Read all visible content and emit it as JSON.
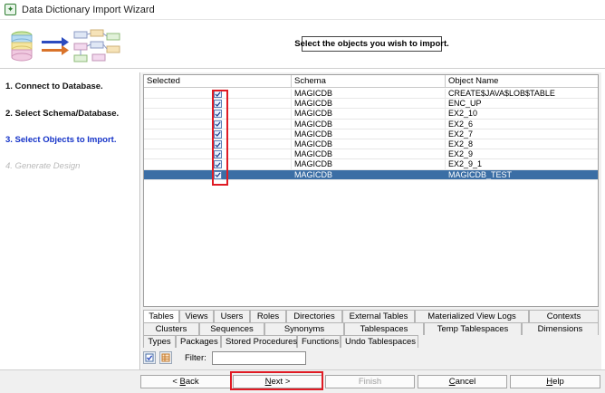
{
  "window": {
    "title": "Data Dictionary Import Wizard"
  },
  "header": {
    "instruction": "Select the objects you wish to import."
  },
  "steps": [
    {
      "label": "1. Connect to Database."
    },
    {
      "label": "2. Select Schema/Database."
    },
    {
      "label": "3. Select Objects to Import."
    },
    {
      "label": "4. Generate Design"
    }
  ],
  "table": {
    "columns": [
      "Selected",
      "Schema",
      "Object Name"
    ],
    "rows": [
      {
        "selected": true,
        "schema": "MAGICDB",
        "object": "CREATE$JAVA$LOB$TABLE"
      },
      {
        "selected": true,
        "schema": "MAGICDB",
        "object": "ENC_UP"
      },
      {
        "selected": true,
        "schema": "MAGICDB",
        "object": "EX2_10"
      },
      {
        "selected": true,
        "schema": "MAGICDB",
        "object": "EX2_6"
      },
      {
        "selected": true,
        "schema": "MAGICDB",
        "object": "EX2_7"
      },
      {
        "selected": true,
        "schema": "MAGICDB",
        "object": "EX2_8"
      },
      {
        "selected": true,
        "schema": "MAGICDB",
        "object": "EX2_9"
      },
      {
        "selected": true,
        "schema": "MAGICDB",
        "object": "EX2_9_1"
      },
      {
        "selected": true,
        "schema": "MAGICDB",
        "object": "MAGICDB_TEST",
        "highlighted": true
      }
    ]
  },
  "tabs": {
    "row1": [
      "Tables",
      "Views",
      "Users",
      "Roles",
      "Directories",
      "External Tables",
      "Materialized View Logs",
      "Contexts"
    ],
    "row2": [
      "Clusters",
      "Sequences",
      "Synonyms",
      "Tablespaces",
      "Temp Tablespaces",
      "Dimensions"
    ],
    "row3": [
      "Types",
      "Packages",
      "Stored Procedures",
      "Functions",
      "Undo Tablespaces"
    ],
    "active": "Tables"
  },
  "filter": {
    "label": "Filter:",
    "value": ""
  },
  "buttons": {
    "back": {
      "prefix": "< ",
      "mnemonic": "B",
      "rest": "ack"
    },
    "next": {
      "mnemonic": "N",
      "rest": "ext",
      "suffix": " >"
    },
    "finish": {
      "label": "Finish"
    },
    "cancel": {
      "mnemonic": "C",
      "rest": "ancel"
    },
    "help": {
      "mnemonic": "H",
      "rest": "elp"
    }
  },
  "colors": {
    "selection": "#3b6ea5",
    "active_step": "#1533c8",
    "annotation": "#e01b24"
  }
}
